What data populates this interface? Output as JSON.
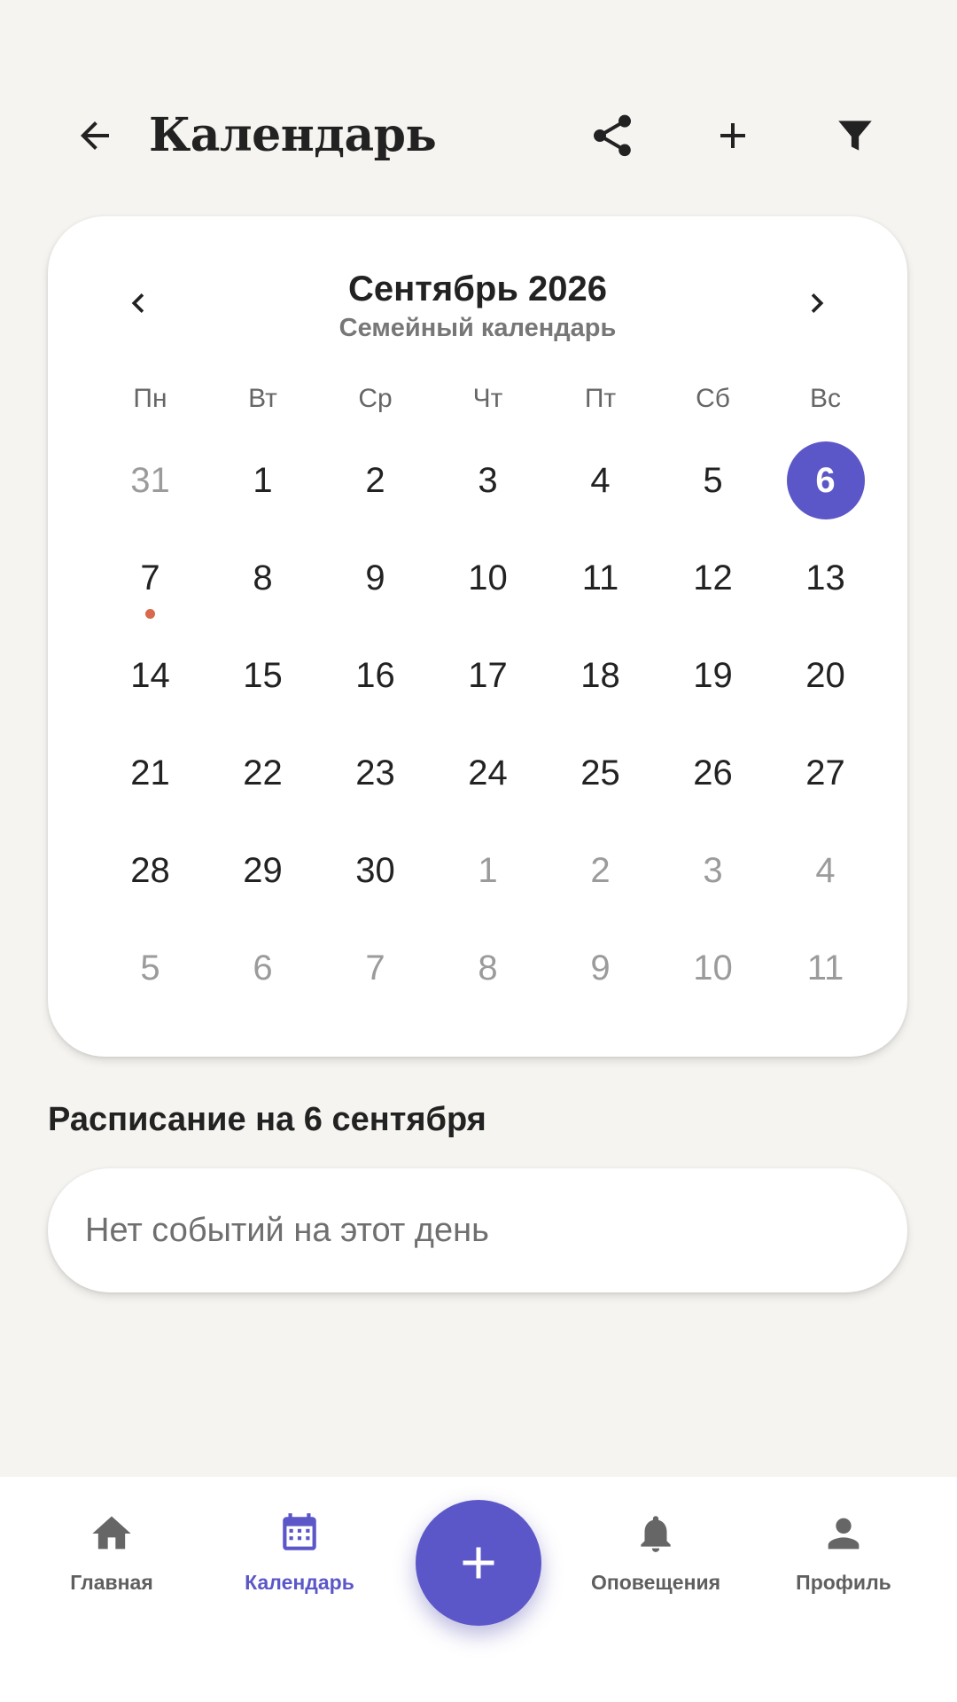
{
  "header": {
    "title": "Календарь",
    "icons": {
      "back": "arrow-left-icon",
      "share": "share-icon",
      "add": "plus-icon",
      "filter": "filter-icon"
    }
  },
  "calendar": {
    "month_title": "Сентябрь 2026",
    "calendar_name": "Семейный календарь",
    "weekdays": [
      "Пн",
      "Вт",
      "Ср",
      "Чт",
      "Пт",
      "Сб",
      "Вс"
    ],
    "days": [
      {
        "label": "31",
        "other": true
      },
      {
        "label": "1"
      },
      {
        "label": "2"
      },
      {
        "label": "3"
      },
      {
        "label": "4"
      },
      {
        "label": "5"
      },
      {
        "label": "6",
        "selected": true
      },
      {
        "label": "7",
        "event": true
      },
      {
        "label": "8"
      },
      {
        "label": "9"
      },
      {
        "label": "10"
      },
      {
        "label": "11"
      },
      {
        "label": "12"
      },
      {
        "label": "13"
      },
      {
        "label": "14"
      },
      {
        "label": "15"
      },
      {
        "label": "16"
      },
      {
        "label": "17"
      },
      {
        "label": "18"
      },
      {
        "label": "19"
      },
      {
        "label": "20"
      },
      {
        "label": "21"
      },
      {
        "label": "22"
      },
      {
        "label": "23"
      },
      {
        "label": "24"
      },
      {
        "label": "25"
      },
      {
        "label": "26"
      },
      {
        "label": "27"
      },
      {
        "label": "28"
      },
      {
        "label": "29"
      },
      {
        "label": "30"
      },
      {
        "label": "1",
        "other": true
      },
      {
        "label": "2",
        "other": true
      },
      {
        "label": "3",
        "other": true
      },
      {
        "label": "4",
        "other": true
      },
      {
        "label": "5",
        "other": true
      },
      {
        "label": "6",
        "other": true
      },
      {
        "label": "7",
        "other": true
      },
      {
        "label": "8",
        "other": true
      },
      {
        "label": "9",
        "other": true
      },
      {
        "label": "10",
        "other": true
      },
      {
        "label": "11",
        "other": true
      }
    ]
  },
  "schedule": {
    "title": "Расписание на 6 сентября",
    "empty_text": "Нет событий на этот день"
  },
  "bottom_nav": {
    "items": [
      {
        "label": "Главная",
        "icon": "home-icon",
        "active": false
      },
      {
        "label": "Календарь",
        "icon": "calendar-icon",
        "active": true
      },
      {
        "label": "Оповещения",
        "icon": "bell-icon",
        "active": false
      },
      {
        "label": "Профиль",
        "icon": "person-icon",
        "active": false
      }
    ],
    "fab_icon": "plus-icon"
  },
  "colors": {
    "accent": "#5b57c8",
    "event_dot": "#d8694a",
    "background": "#f6f4f0",
    "card": "#ffffff",
    "text": "#222222",
    "muted": "#9b9b9b"
  }
}
